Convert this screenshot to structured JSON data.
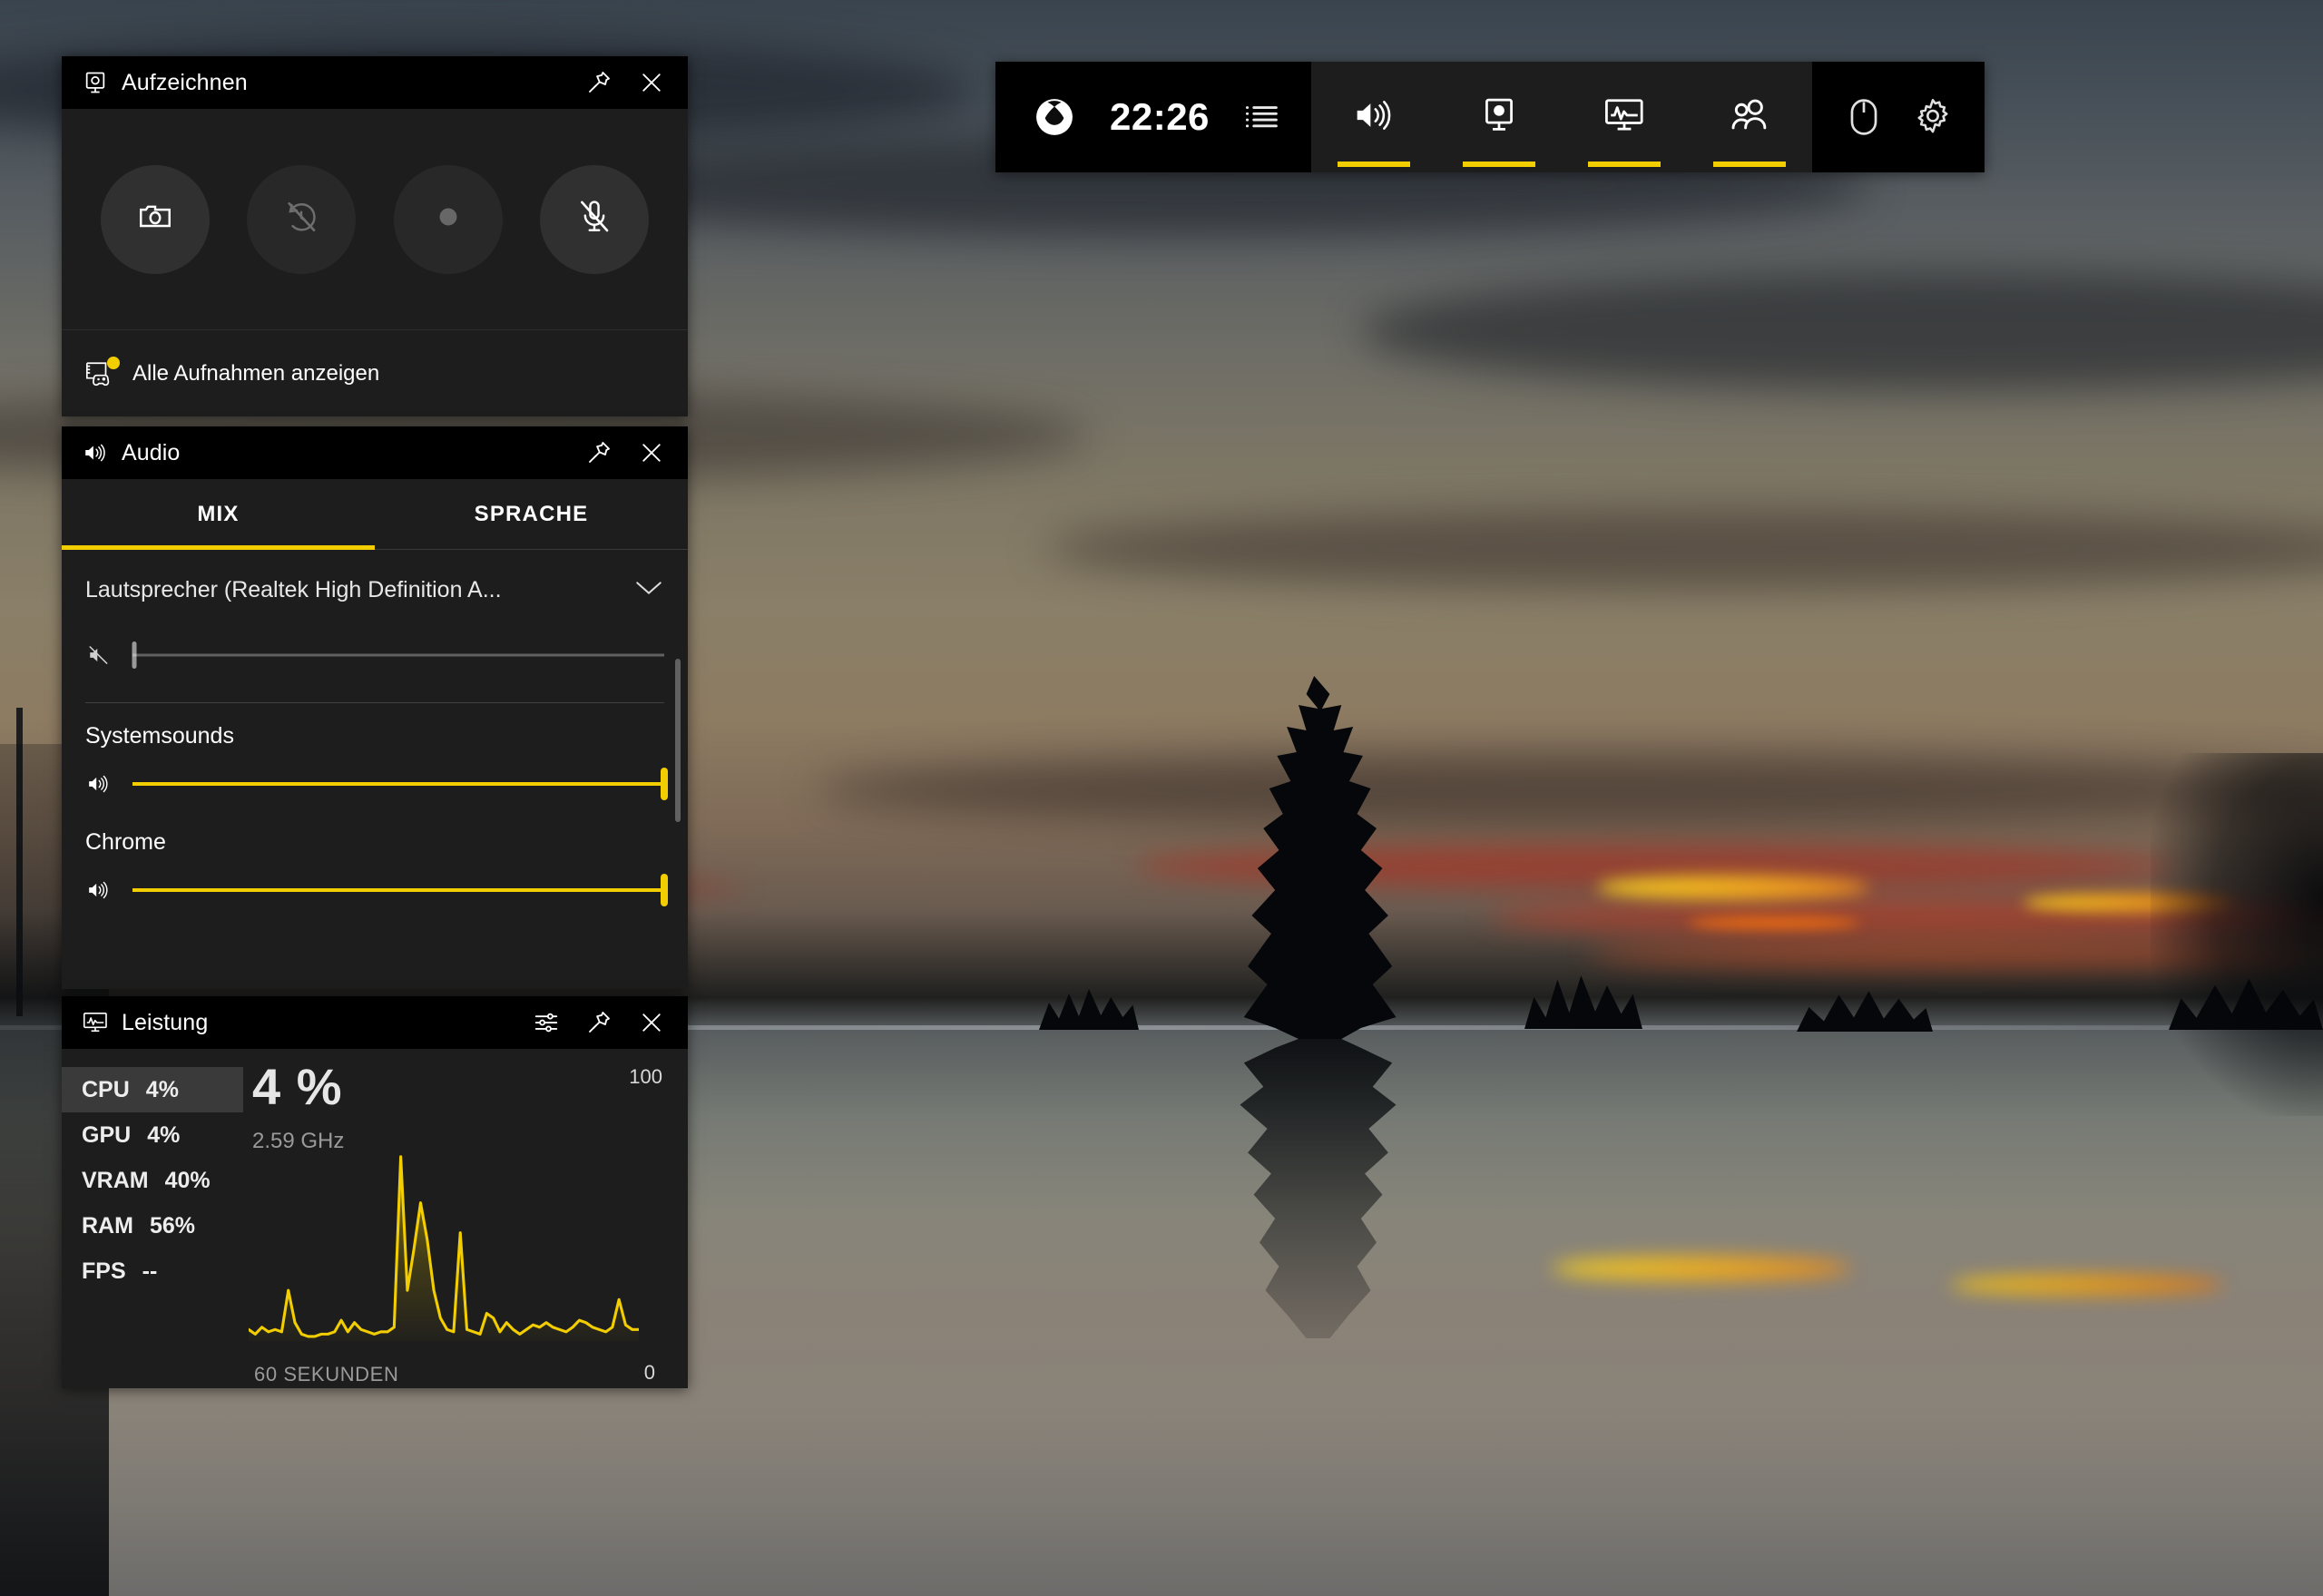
{
  "wallpaper": {
    "description": "sunset-over-water-with-tree-silhouette",
    "sky_top_color": "#3a444e",
    "sunset_color": "#8d7b62",
    "highlight_color": "#f5d020",
    "ember_color": "#c0392b"
  },
  "toolbar": {
    "xbox_icon": "xbox-logo-icon",
    "clock": "22:26",
    "menu_icon": "list-menu-icon",
    "widgets": [
      {
        "icon": "audio-speaker-icon",
        "name": "audio",
        "active": true
      },
      {
        "icon": "capture-record-icon",
        "name": "capture",
        "active": true
      },
      {
        "icon": "performance-monitor-icon",
        "name": "performance",
        "active": true
      },
      {
        "icon": "people-social-icon",
        "name": "social",
        "active": true
      }
    ],
    "system": [
      {
        "icon": "mouse-pointer-icon",
        "name": "mouse-mode"
      },
      {
        "icon": "gear-settings-icon",
        "name": "settings"
      }
    ]
  },
  "record_widget": {
    "title": "Aufzeichnen",
    "title_icon": "capture-record-icon",
    "pin_icon": "pin-icon",
    "close_icon": "close-icon",
    "buttons": [
      {
        "name": "screenshot",
        "icon": "camera-icon",
        "dimmed": false
      },
      {
        "name": "record-last-30-seconds",
        "icon": "clock-slash-icon",
        "dimmed": true
      },
      {
        "name": "start-recording",
        "icon": "record-dot-icon",
        "dimmed": true
      },
      {
        "name": "toggle-microphone",
        "icon": "microphone-muted-icon",
        "dimmed": false
      }
    ],
    "footer_label": "Alle Aufnahmen anzeigen",
    "footer_icon": "gallery-gamepad-icon",
    "footer_badge": true
  },
  "audio_widget": {
    "title": "Audio",
    "title_icon": "audio-speaker-icon",
    "pin_icon": "pin-icon",
    "close_icon": "close-icon",
    "tabs": [
      {
        "label": "MIX",
        "active": true
      },
      {
        "label": "SPRACHE",
        "active": false
      }
    ],
    "device": {
      "label": "Lautsprecher (Realtek High Definition A...",
      "chevron_icon": "chevron-down-icon"
    },
    "master_slider": {
      "icon": "speaker-muted-icon",
      "value": 0
    },
    "apps": [
      {
        "name": "Systemsounds",
        "icon": "speaker-icon",
        "value": 100
      },
      {
        "name": "Chrome",
        "icon": "speaker-icon",
        "value": 100
      }
    ],
    "accent_color": "#f2cd00"
  },
  "performance_widget": {
    "title": "Leistung",
    "title_icon": "performance-monitor-icon",
    "options_icon": "sliders-options-icon",
    "pin_icon": "pin-icon",
    "close_icon": "close-icon",
    "metrics": [
      {
        "label": "CPU",
        "value": "4%",
        "active": true
      },
      {
        "label": "GPU",
        "value": "4%",
        "active": false
      },
      {
        "label": "VRAM",
        "value": "40%",
        "active": false
      },
      {
        "label": "RAM",
        "value": "56%",
        "active": false
      },
      {
        "label": "FPS",
        "value": "--",
        "active": false
      }
    ],
    "headline_value": "4 %",
    "sub_value": "2.59 GHz",
    "chart_axis_max": "100",
    "chart_axis_min": "0",
    "chart_time_label": "60 SEKUNDEN"
  },
  "chart_data": {
    "type": "area",
    "title": "CPU",
    "xlabel": "60 SEKUNDEN",
    "ylabel": "%",
    "ylim": [
      0,
      100
    ],
    "grid": false,
    "legend": "none",
    "line_color": "#f2cd00",
    "fill": "gradient-yellow-to-transparent",
    "x": [
      0,
      1,
      2,
      3,
      4,
      5,
      6,
      7,
      8,
      9,
      10,
      11,
      12,
      13,
      14,
      15,
      16,
      17,
      18,
      19,
      20,
      21,
      22,
      23,
      24,
      25,
      26,
      27,
      28,
      29,
      30,
      31,
      32,
      33,
      34,
      35,
      36,
      37,
      38,
      39,
      40,
      41,
      42,
      43,
      44,
      45,
      46,
      47,
      48,
      49,
      50,
      51,
      52,
      53,
      54,
      55,
      56,
      57,
      58,
      59
    ],
    "values": [
      5,
      3,
      6,
      4,
      5,
      4,
      22,
      8,
      3,
      2,
      2,
      3,
      3,
      4,
      9,
      4,
      8,
      5,
      4,
      3,
      4,
      4,
      6,
      80,
      22,
      40,
      60,
      44,
      22,
      10,
      5,
      4,
      47,
      5,
      4,
      3,
      12,
      10,
      4,
      8,
      5,
      3,
      5,
      7,
      6,
      8,
      6,
      5,
      4,
      6,
      9,
      8,
      6,
      5,
      4,
      6,
      18,
      7,
      5,
      5
    ]
  }
}
